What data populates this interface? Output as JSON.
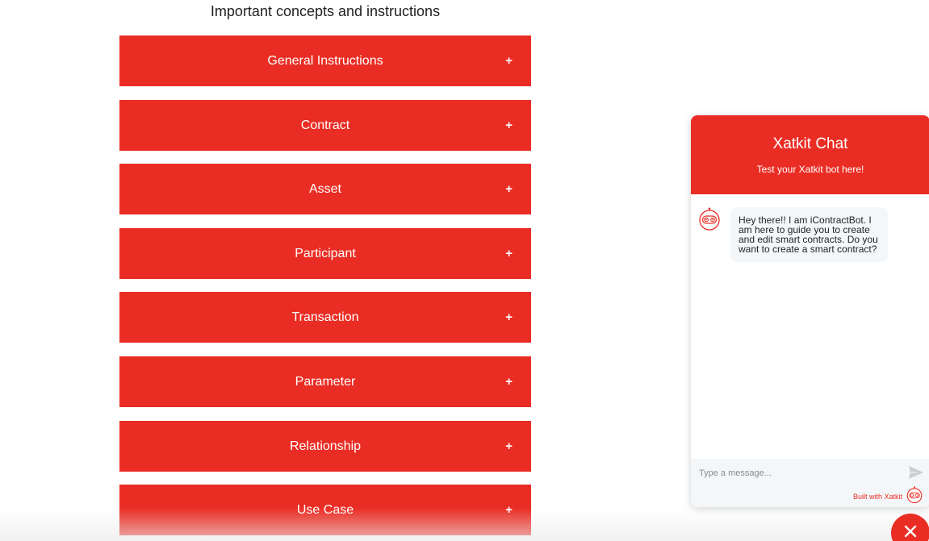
{
  "page": {
    "title": "Important concepts and instructions"
  },
  "accordion": {
    "items": [
      {
        "label": "General Instructions",
        "toggle": "+"
      },
      {
        "label": "Contract",
        "toggle": "+"
      },
      {
        "label": "Asset",
        "toggle": "+"
      },
      {
        "label": "Participant",
        "toggle": "+"
      },
      {
        "label": "Transaction",
        "toggle": "+"
      },
      {
        "label": "Parameter",
        "toggle": "+"
      },
      {
        "label": "Relationship",
        "toggle": "+"
      },
      {
        "label": "Use Case",
        "toggle": "+"
      }
    ]
  },
  "chat": {
    "title": "Xatkit Chat",
    "subtitle": "Test your Xatkit bot here!",
    "bot_message": "Hey there!! I am iContractBot. I am here to guide you to create and edit smart contracts. Do you want to create a smart contract?",
    "input_placeholder": "Type a message...",
    "built_with": "Built with Xatkit",
    "avatar_icon": "robot-icon",
    "send_icon": "send-icon",
    "close_icon": "close-icon"
  },
  "colors": {
    "accent": "#ea2d24",
    "bubble": "#f4f7f9"
  }
}
